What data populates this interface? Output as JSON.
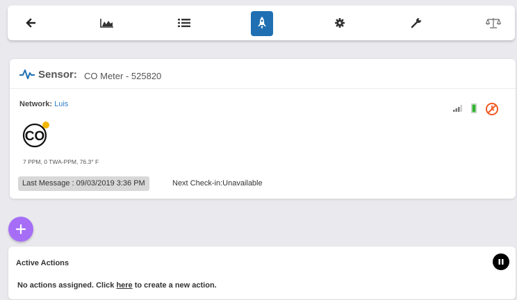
{
  "colors": {
    "background": "#e9e9ee",
    "active_nav": "#1f6fb2",
    "network_link": "#2f7fc4",
    "add_button": "#a66ef6",
    "battery": "#34b233",
    "no_checkin": "#f15a24",
    "co_badge": "#f2b705"
  },
  "navbar": {
    "items": [
      {
        "icon": "back-arrow-icon",
        "active": false
      },
      {
        "icon": "chart-icon",
        "active": false
      },
      {
        "icon": "list-icon",
        "active": false
      },
      {
        "icon": "rocket-icon",
        "active": true
      },
      {
        "icon": "gear-icon",
        "active": false
      },
      {
        "icon": "wrench-icon",
        "active": false
      },
      {
        "icon": "scale-icon",
        "active": false
      }
    ]
  },
  "sensor": {
    "label": "Sensor:",
    "name": "CO Meter - 525820",
    "network_label": "Network:",
    "network_value": "Luis",
    "icon_text": "CO",
    "reading": "7 PPM, 0 TWA-PPM, 76.3° F",
    "last_message": "Last Message : 09/03/2019 3:36 PM",
    "next_checkin": "Next Check-in:Unavailable",
    "status_icons": [
      "signal-icon",
      "battery-icon",
      "no-checkin-icon"
    ]
  },
  "actions": {
    "title": "Active Actions",
    "text_before": "No actions assigned. Click ",
    "link_text": "here",
    "text_after": " to create a new action."
  }
}
